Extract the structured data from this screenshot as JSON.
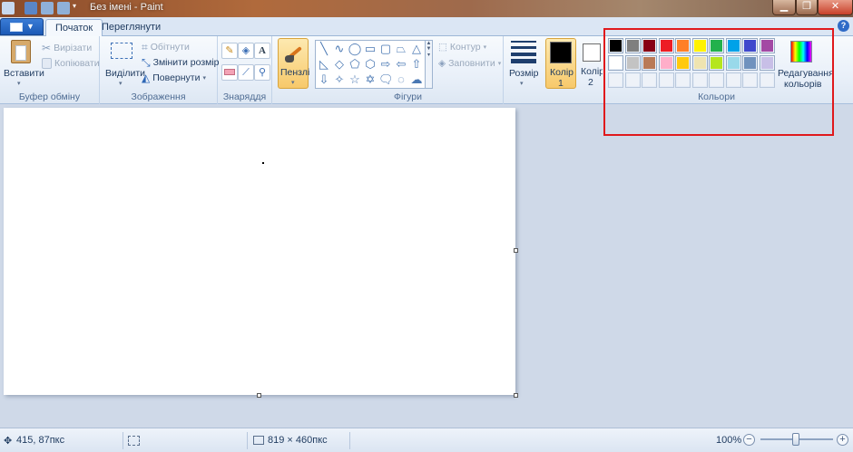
{
  "window": {
    "title": "Без імені - Paint"
  },
  "tabs": [
    {
      "label": "Початок",
      "active": true
    },
    {
      "label": "Переглянути",
      "active": false
    }
  ],
  "ribbon": {
    "clipboard": {
      "paste_label": "Вставити",
      "cut_label": "Вирізати",
      "copy_label": "Копіювати",
      "group_label": "Буфер обміну"
    },
    "image": {
      "select_label": "Виділити",
      "crop_label": "Обітнути",
      "resize_label": "Змінити розмір",
      "rotate_label": "Повернути",
      "group_label": "Зображення"
    },
    "tools": {
      "group_label": "Знаряддя",
      "text_glyph": "A"
    },
    "brushes": {
      "label": "Пензлі"
    },
    "shapes": {
      "group_label": "Фігури",
      "outline_label": "Контур",
      "fill_label": "Заповнити"
    },
    "size": {
      "label": "Розмір"
    },
    "color1": {
      "label_line1": "Колір",
      "label_line2": "1",
      "value": "#000000"
    },
    "color2": {
      "label_line1": "Колір",
      "label_line2": "2",
      "value": "#ffffff"
    },
    "colors": {
      "group_label": "Кольори",
      "edit_label_line1": "Редагування",
      "edit_label_line2": "кольорів",
      "row1": [
        "#000000",
        "#7f7f7f",
        "#880015",
        "#ed1c24",
        "#ff7f27",
        "#fff200",
        "#22b14c",
        "#00a2e8",
        "#3f48cc",
        "#a349a4"
      ],
      "row2": [
        "#ffffff",
        "#c3c3c3",
        "#b97a57",
        "#ffaec9",
        "#ffc90e",
        "#efe4b0",
        "#b5e61d",
        "#99d9ea",
        "#7092be",
        "#c8bfe7"
      ],
      "row3": [
        "",
        "",
        "",
        "",
        "",
        "",
        "",
        "",
        "",
        ""
      ]
    }
  },
  "status": {
    "cursor_pos": "415, 87пкс",
    "image_size": "819 × 460пкс",
    "zoom": "100%"
  }
}
